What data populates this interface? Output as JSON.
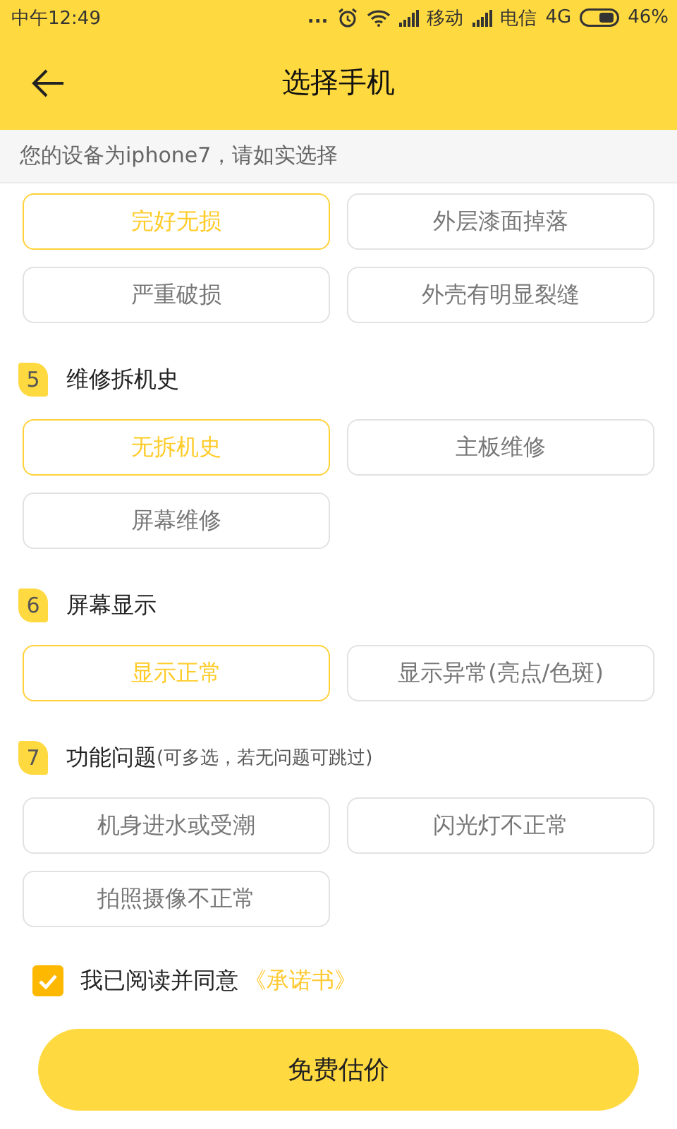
{
  "status_bar": {
    "time": "中午12:49",
    "more": "...",
    "carrier_1": "移动",
    "carrier_2": "电信",
    "network": "4G",
    "battery": "46%"
  },
  "header": {
    "title": "选择手机"
  },
  "notice": "您的设备为iphone7，请如实选择",
  "sections": [
    {
      "options": [
        {
          "label": "完好无损",
          "selected": true
        },
        {
          "label": "外层漆面掉落",
          "selected": false
        },
        {
          "label": "严重破损",
          "selected": false
        },
        {
          "label": "外壳有明显裂缝",
          "selected": false
        }
      ]
    },
    {
      "number": "5",
      "title": "维修拆机史",
      "options": [
        {
          "label": "无拆机史",
          "selected": true
        },
        {
          "label": "主板维修",
          "selected": false
        },
        {
          "label": "屏幕维修",
          "selected": false
        }
      ]
    },
    {
      "number": "6",
      "title": "屏幕显示",
      "options": [
        {
          "label": "显示正常",
          "selected": true
        },
        {
          "label": "显示异常(亮点/色斑)",
          "selected": false
        }
      ]
    },
    {
      "number": "7",
      "title": "功能问题",
      "note": "(可多选，若无问题可跳过)",
      "options": [
        {
          "label": "机身进水或受潮",
          "selected": false
        },
        {
          "label": "闪光灯不正常",
          "selected": false
        },
        {
          "label": "拍照摄像不正常",
          "selected": false
        }
      ]
    }
  ],
  "agreement": {
    "checked": true,
    "text": "我已阅读并同意",
    "link": "《承诺书》"
  },
  "submit": "免费估价"
}
